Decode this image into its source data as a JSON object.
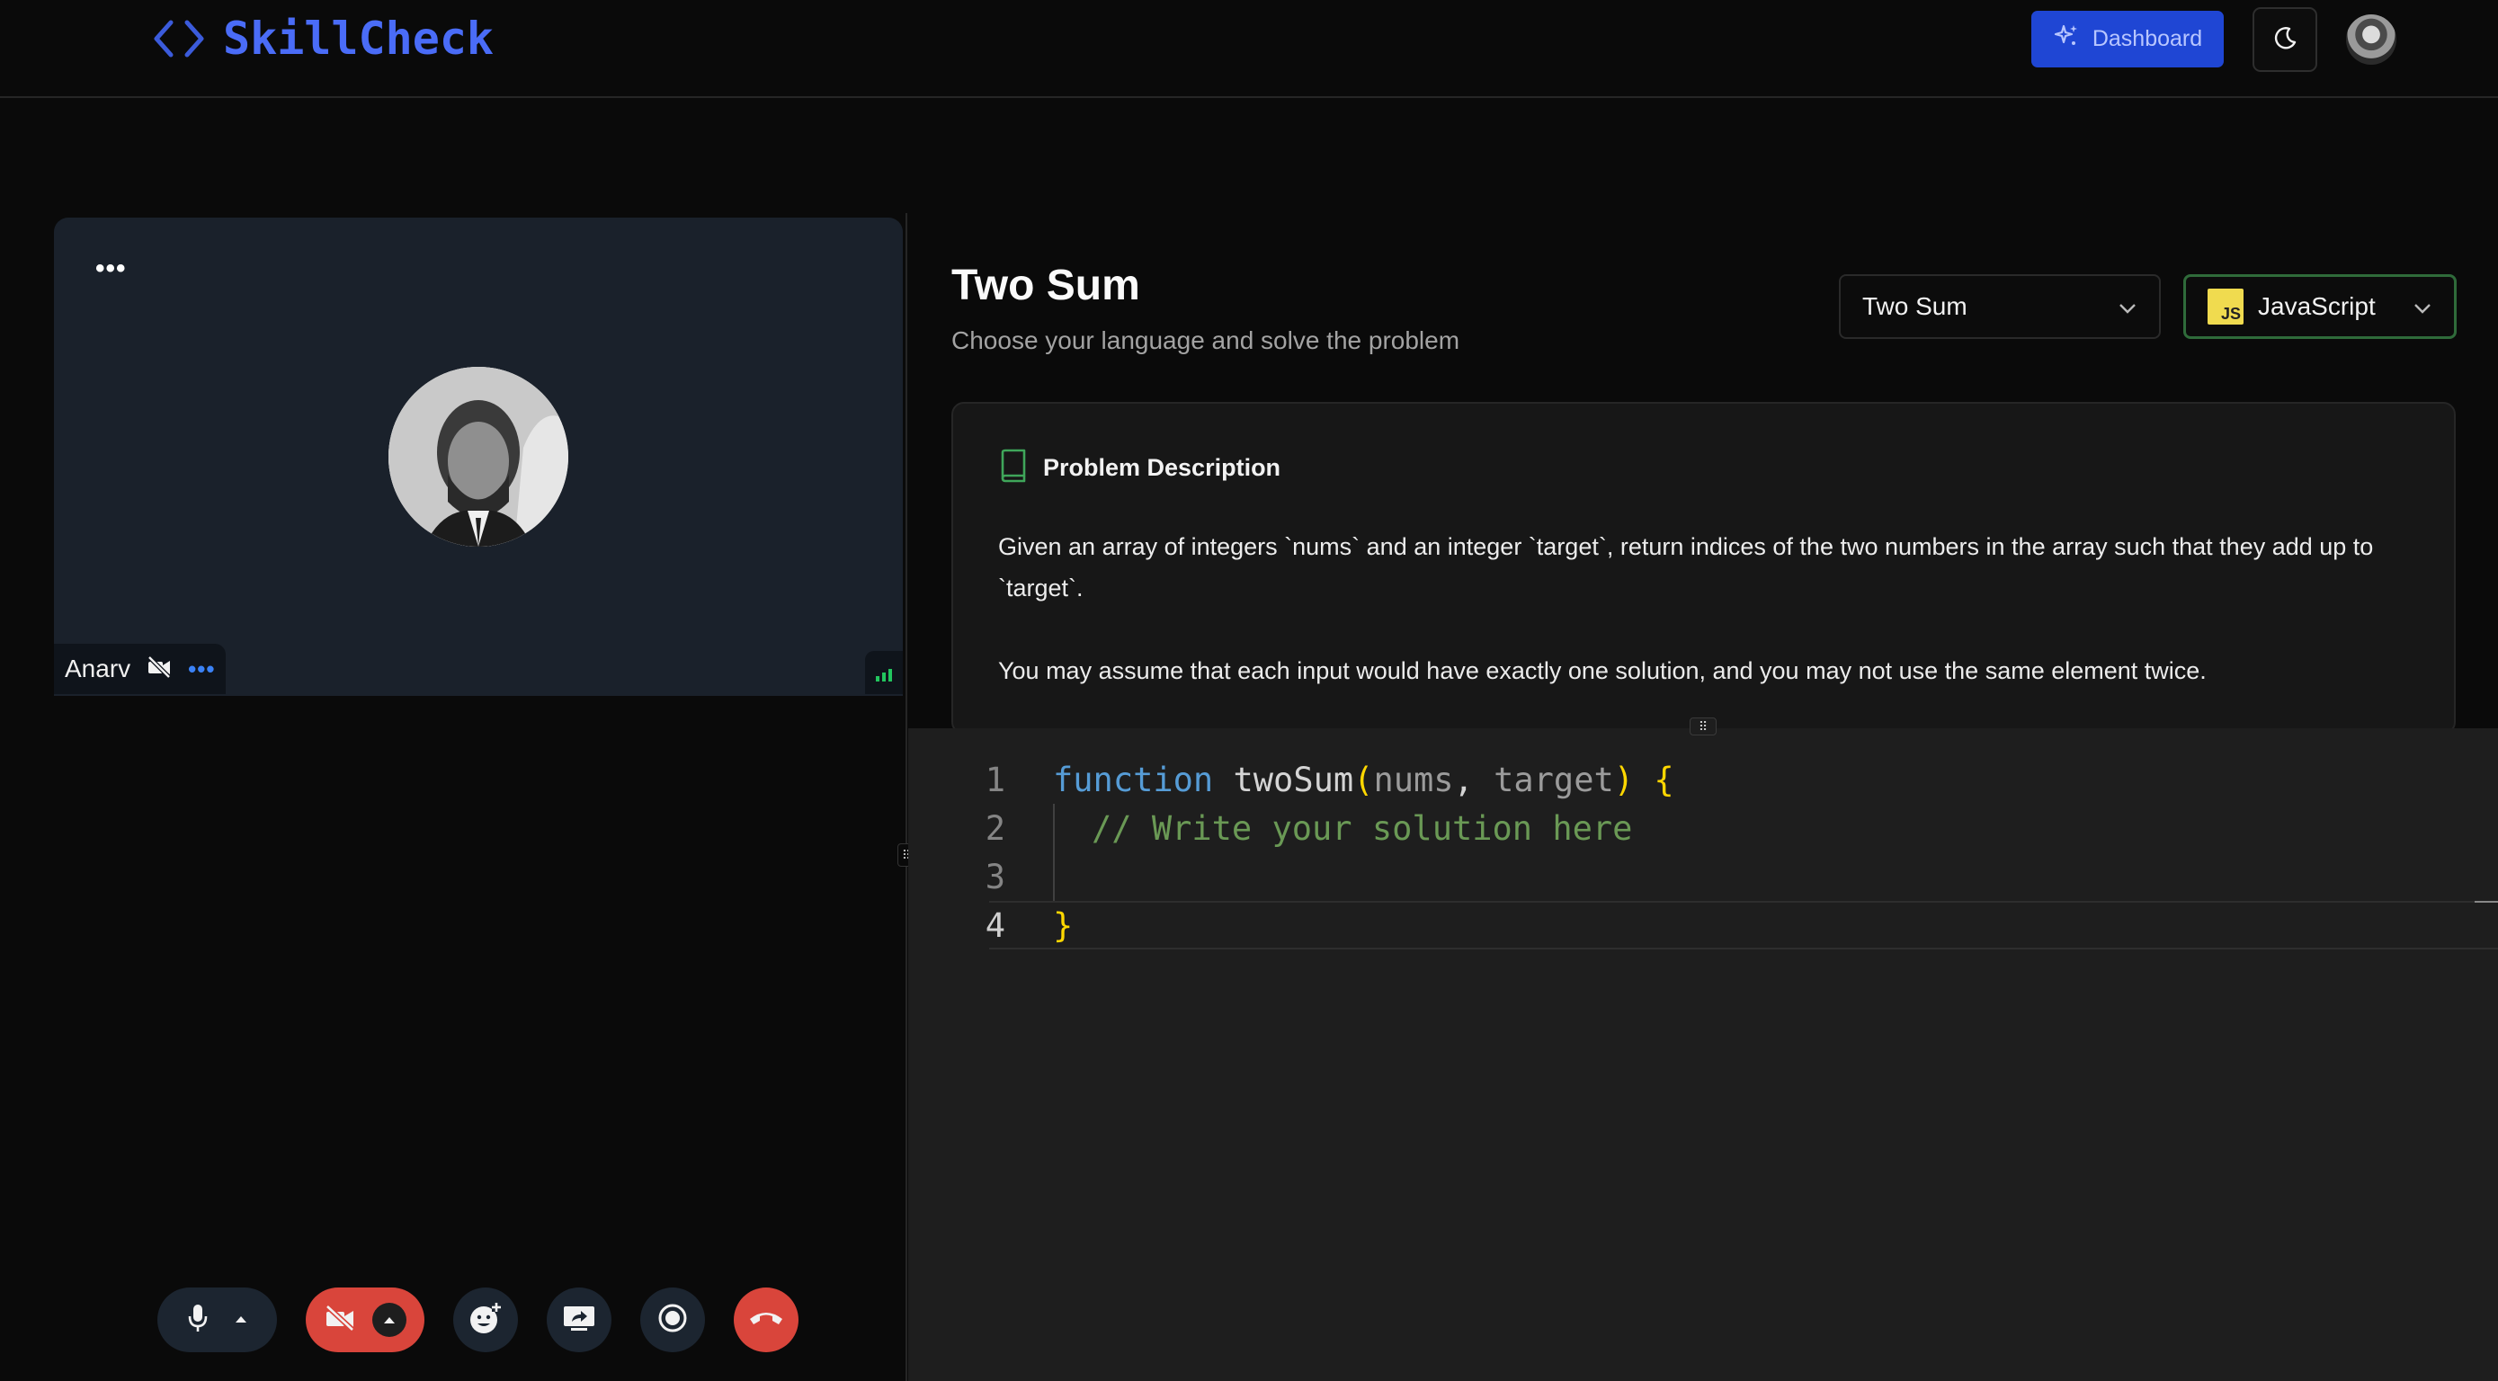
{
  "header": {
    "logo_text": "SkillCheck",
    "dashboard_label": "Dashboard",
    "icons": {
      "logo": "code-brackets-icon",
      "dashboard": "sparkles-icon",
      "theme": "moon-icon"
    }
  },
  "video": {
    "participant_name": "Anarv",
    "menu_glyph": "•••",
    "camera_off": true
  },
  "controls": [
    "mic-icon",
    "camera-off-icon",
    "emoji-add-icon",
    "screen-share-icon",
    "record-icon",
    "end-call-icon"
  ],
  "problem": {
    "title": "Two Sum",
    "subtitle": "Choose your language and solve the problem",
    "selected_problem": "Two Sum",
    "selected_language": "JavaScript",
    "language_badge": "JS",
    "description_heading": "Problem Description",
    "paragraphs": [
      "Given an array of integers `nums` and an integer `target`, return indices of the two numbers in the array such that they add up to `target`.",
      "You may assume that each input would have exactly one solution, and you may not use the same element twice."
    ]
  },
  "editor": {
    "line_numbers": [
      "1",
      "2",
      "3",
      "4"
    ],
    "tokens": {
      "keyword": "function",
      "fn_name": "twoSum",
      "open_paren": "(",
      "param1": "nums",
      "comma": ", ",
      "param2": "target",
      "close_paren": ")",
      "open_brace": "{",
      "comment": "// Write your solution here",
      "close_brace": "}"
    }
  },
  "colors": {
    "accent": "#1f46d4",
    "logo": "#4a6cf7",
    "end_call": "#d9453b",
    "success": "#22c55e"
  }
}
